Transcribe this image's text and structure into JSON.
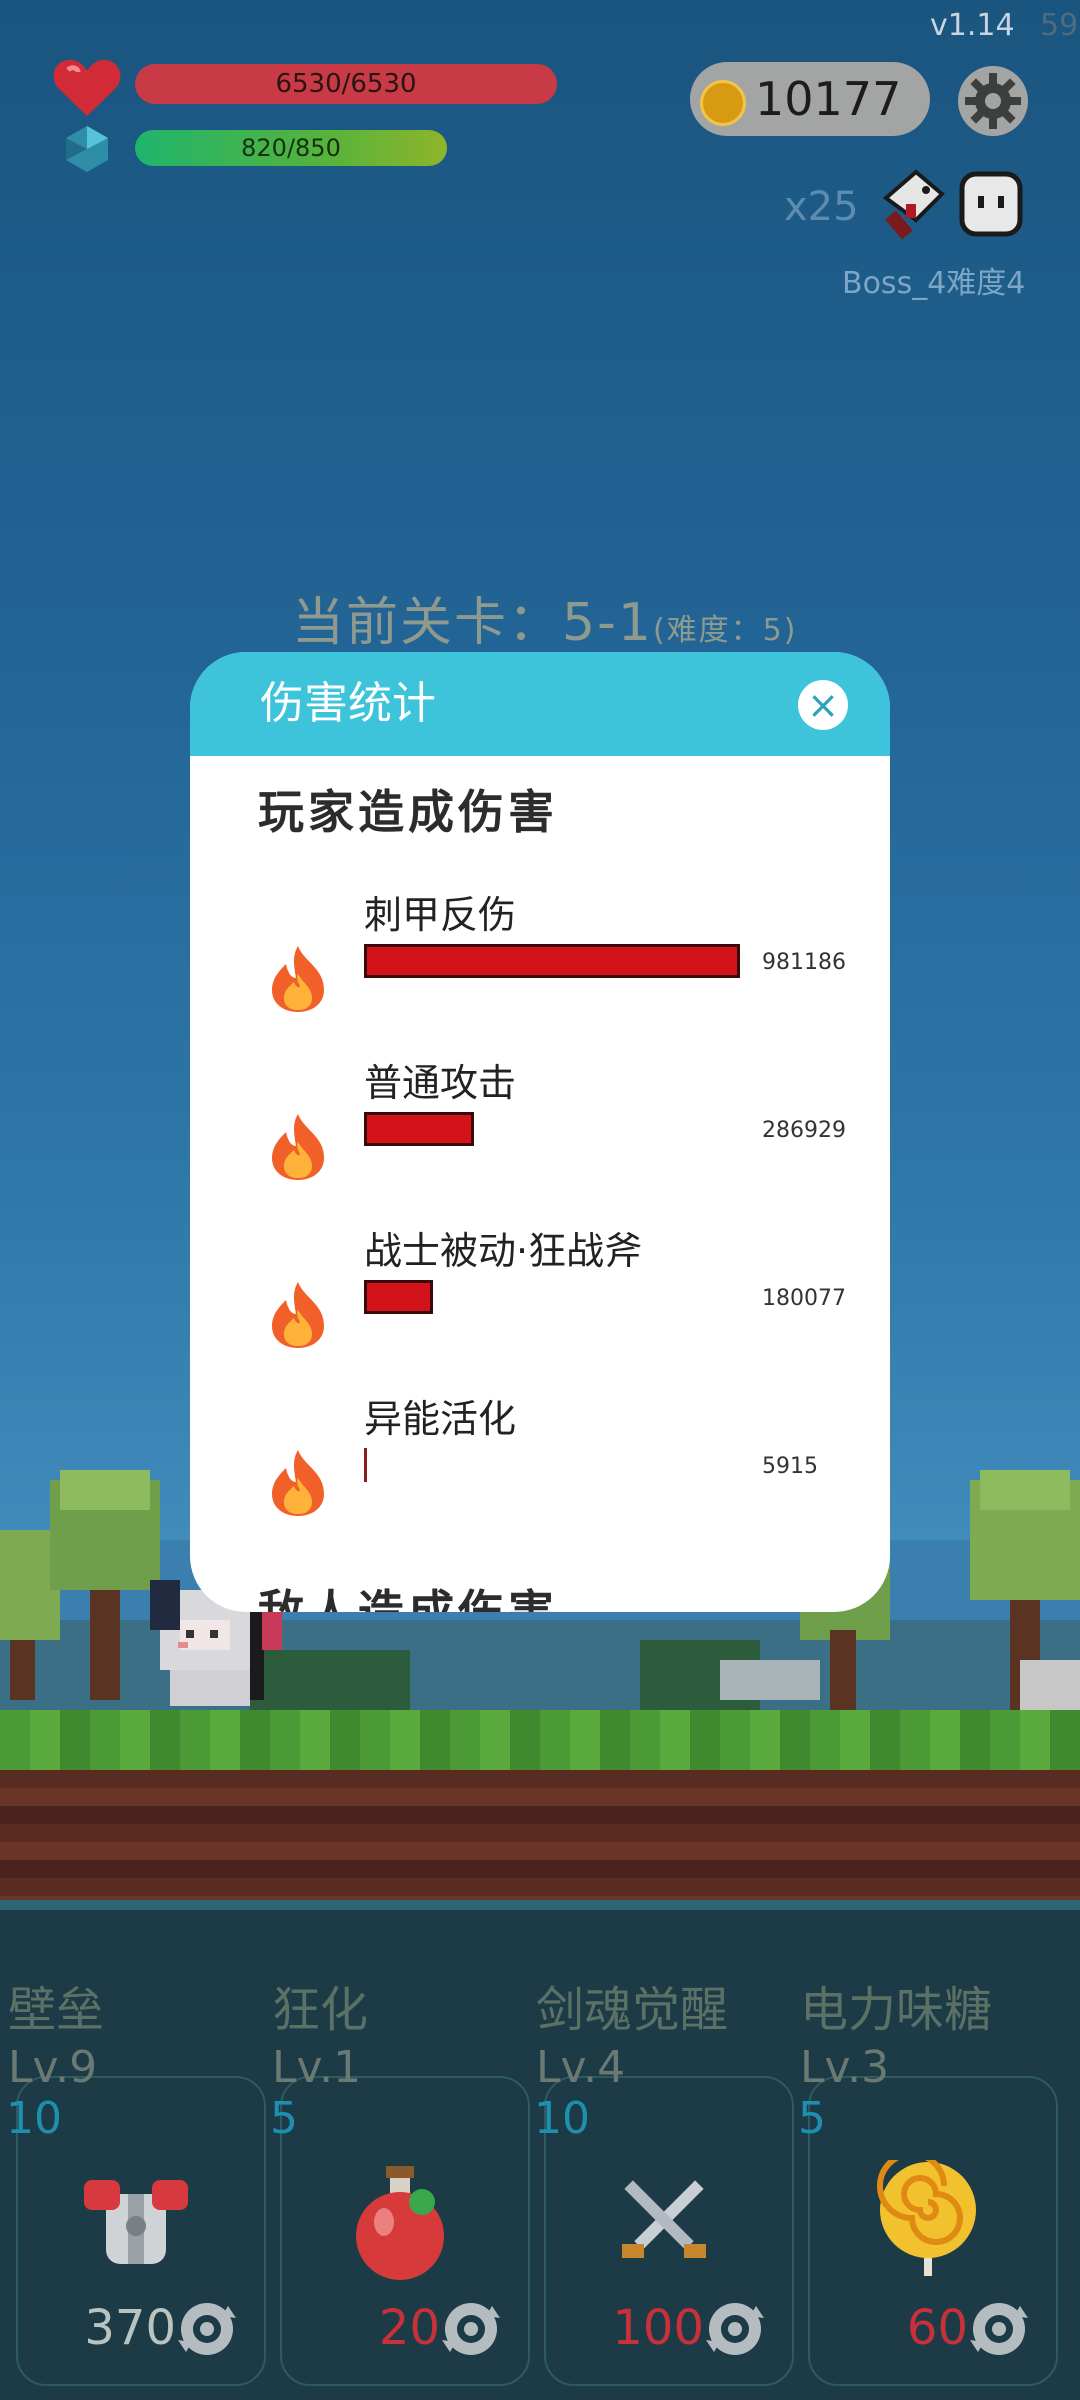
{
  "hud": {
    "version": "v1.14",
    "fps": "59",
    "hp_text": "6530/6530",
    "mp_text": "820/850",
    "mp_fraction": 0.965,
    "coins": "10177",
    "multiplier": "x25",
    "boss_label": "Boss_4难度4",
    "icons": [
      "heart-icon",
      "mana-crystal-icon",
      "coin-icon",
      "gear-icon",
      "cleaver-icon",
      "ghost-icon"
    ]
  },
  "stage": {
    "label": "当前关卡：5-1",
    "difficulty": "(难度：5)"
  },
  "modal": {
    "title": "伤害统计",
    "close_label": "×",
    "section_player": "玩家造成伤害",
    "section_enemy": "敌人造成伤害",
    "rows": [
      {
        "name": "刺甲反伤",
        "value": "981186",
        "fraction": 1.0
      },
      {
        "name": "普通攻击",
        "value": "286929",
        "fraction": 0.292
      },
      {
        "name": "战士被动·狂战斧",
        "value": "180077",
        "fraction": 0.184
      },
      {
        "name": "异能活化",
        "value": "5915",
        "fraction": 0.006
      }
    ]
  },
  "skills": [
    {
      "name": "壁垒",
      "level": "Lv.9",
      "count": "10",
      "cost": "370",
      "cost_color": "#b9c3bf",
      "icon": "armor-icon"
    },
    {
      "name": "狂化",
      "level": "Lv.1",
      "count": "5",
      "cost": "20",
      "cost_color": "#c8303a",
      "icon": "potion-icon"
    },
    {
      "name": "剑魂觉醒",
      "level": "Lv.4",
      "count": "10",
      "cost": "100",
      "cost_color": "#c8303a",
      "icon": "crossed-swords-icon"
    },
    {
      "name": "电力味糖",
      "level": "Lv.3",
      "count": "5",
      "cost": "60",
      "cost_color": "#c8303a",
      "icon": "lollipop-icon"
    }
  ],
  "colors": {
    "accent": "#3dc3da",
    "damage_bar": "#d3121a",
    "hp": "#c83a46"
  }
}
